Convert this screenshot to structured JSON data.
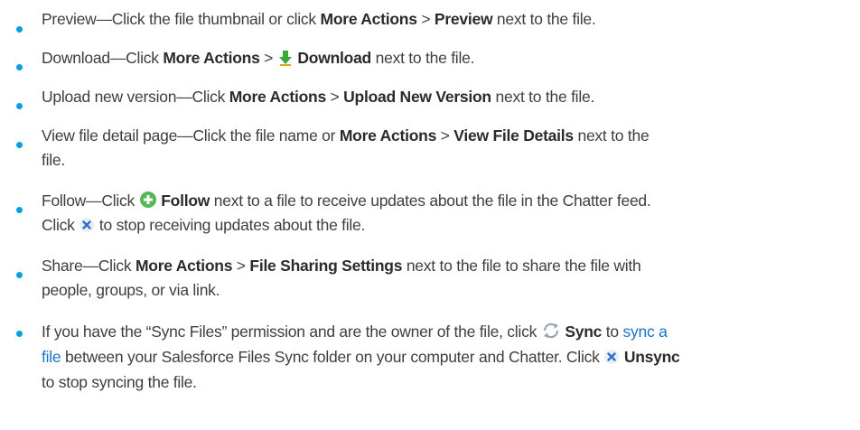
{
  "colors": {
    "bullet": "#0a9ee0",
    "text": "#3e3e3c",
    "link": "#1a73c9",
    "download_icon": "#3aa83a",
    "follow_icon": "#56b756",
    "remove_icon": "#2f6fc8",
    "sync_icon": "#9aa3ad"
  },
  "items": [
    {
      "lead": "Preview—Click the file thumbnail or click ",
      "action1": "More Actions",
      "sep": " > ",
      "action2": "Preview",
      "tail": " next to the file."
    },
    {
      "lead": "Download—Click ",
      "action1": "More Actions",
      "sep": " > ",
      "icon": "download-arrow-icon",
      "action2": "Download",
      "tail": " next to the file."
    },
    {
      "lead": "Upload new version—Click ",
      "action1": "More Actions",
      "sep": " > ",
      "action2": "Upload New Version",
      "tail": " next to the file."
    },
    {
      "lead": "View file detail page—Click the file name or ",
      "action1": "More Actions",
      "sep": " > ",
      "action2": "View File Details",
      "tail_line1": " next to the",
      "tail_line2": "file."
    },
    {
      "lead": "Follow—Click ",
      "icon": "follow-plus-icon",
      "action1": "Follow",
      "tail_line1": " next to a file to receive updates about the file in the Chatter feed.",
      "line2_lead": "Click ",
      "icon2": "remove-x-icon",
      "line2_tail": " to stop receiving updates about the file."
    },
    {
      "lead": "Share—Click ",
      "action1": "More Actions",
      "sep": " > ",
      "action2": "File Sharing Settings",
      "tail_line1": " next to the file to share the file with",
      "tail_line2": "people, groups, or via link."
    },
    {
      "lead": "If you have the “Sync Files” permission and are the owner of the file, click ",
      "icon": "sync-icon",
      "action1": "Sync",
      "mid": " to ",
      "link1": "sync a",
      "link2": "file",
      "line2_text": " between your Salesforce Files Sync folder on your computer and Chatter. Click ",
      "icon2": "remove-x-icon",
      "action2": "Unsync",
      "line3_text": "to stop syncing the file."
    }
  ]
}
